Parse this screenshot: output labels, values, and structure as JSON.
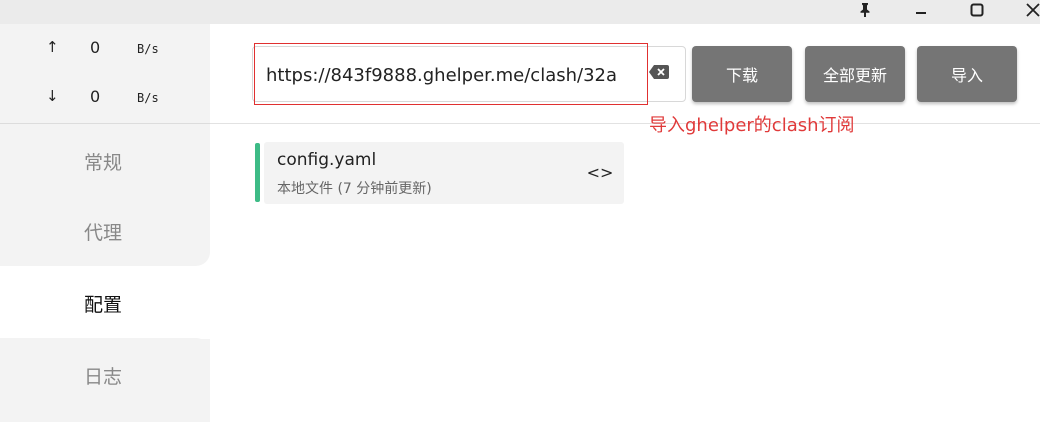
{
  "titlebar": {
    "pin_icon": "pin-icon",
    "minimize_icon": "minimize-icon",
    "maximize_icon": "maximize-icon",
    "close_icon": "close-icon"
  },
  "traffic": {
    "up_arrow": "↑",
    "up_value": "0",
    "up_unit": "B/s",
    "down_arrow": "↓",
    "down_value": "0",
    "down_unit": "B/s"
  },
  "nav": {
    "general": "常规",
    "proxy": "代理",
    "config": "配置",
    "log": "日志",
    "active": "config"
  },
  "url_bar": {
    "value": "https://843f9888.ghelper.me/clash/32a"
  },
  "buttons": {
    "download": "下载",
    "update_all": "全部更新",
    "import": "导入"
  },
  "annotation": {
    "text": "导入ghelper的clash订阅",
    "color": "#e03a3a"
  },
  "profiles": [
    {
      "name": "config.yaml",
      "subtitle": "本地文件 (7 分钟前更新)",
      "edit_icon": "<>"
    }
  ],
  "colors": {
    "accent": "#3dbb86",
    "button_bg": "#757575",
    "sidebar_bg": "#f3f3f3"
  }
}
